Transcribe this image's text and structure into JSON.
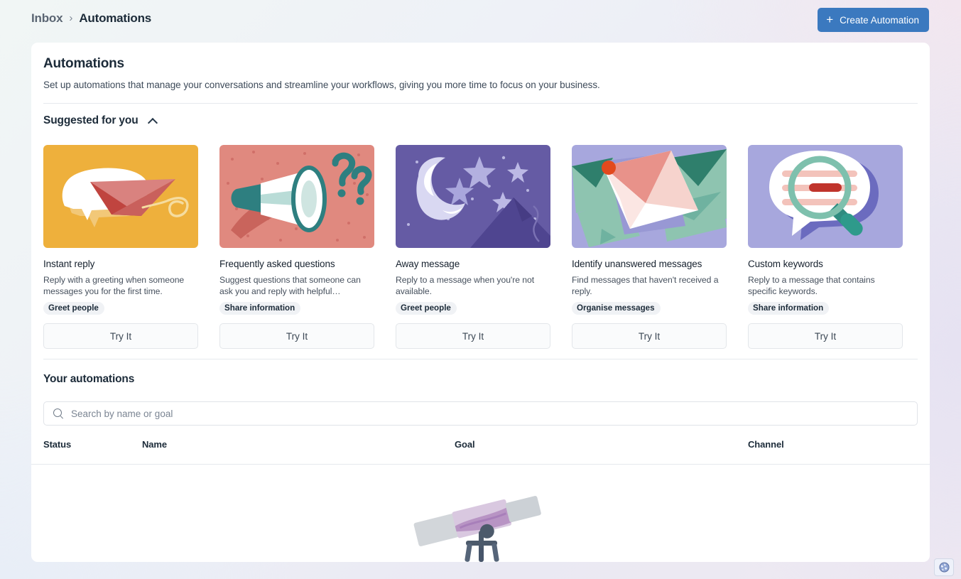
{
  "breadcrumb": {
    "parent": "Inbox",
    "separator": "›",
    "current": "Automations"
  },
  "header": {
    "create_button_label": "Create Automation",
    "create_button_icon": "plus-icon",
    "create_button_color": "#3b79bf"
  },
  "page": {
    "title": "Automations",
    "subtitle": "Set up automations that manage your conversations and streamline your workflows, giving you more time to focus on your business."
  },
  "suggested": {
    "heading": "Suggested for you",
    "collapse_icon": "chevron-up-icon",
    "cards": [
      {
        "title": "Instant reply",
        "description": "Reply with a greeting when someone messages you for the first time.",
        "badge": "Greet people",
        "button_label": "Try It",
        "thumb_name": "instant-reply-illustration",
        "thumb_bg": "#eeb03c"
      },
      {
        "title": "Frequently asked questions",
        "description": "Suggest questions that someone can ask you and reply with helpful…",
        "badge": "Share information",
        "button_label": "Try It",
        "thumb_name": "faq-megaphone-illustration",
        "thumb_bg": "#e0897f"
      },
      {
        "title": "Away message",
        "description": "Reply to a message when you're not available.",
        "badge": "Greet people",
        "button_label": "Try It",
        "thumb_name": "away-message-night-illustration",
        "thumb_bg": "#655ba4"
      },
      {
        "title": "Identify unanswered messages",
        "description": "Find messages that haven't received a reply.",
        "badge": "Organise messages",
        "button_label": "Try It",
        "thumb_name": "unanswered-envelopes-illustration",
        "thumb_bg": "#a7a7dd"
      },
      {
        "title": "Custom keywords",
        "description": "Reply to a message that contains specific keywords.",
        "badge": "Share information",
        "button_label": "Try It",
        "thumb_name": "custom-keywords-magnifier-illustration",
        "thumb_bg": "#a7a7dd"
      }
    ]
  },
  "your_automations": {
    "heading": "Your automations",
    "search": {
      "placeholder": "Search by name or goal",
      "value": "",
      "icon": "search-icon"
    },
    "table": {
      "columns": [
        "Status",
        "Name",
        "Goal",
        "Channel"
      ],
      "rows": []
    },
    "empty_state_illustration": "telescope-illustration"
  },
  "footer": {
    "globe_icon": "globe-icon"
  },
  "scrollbar": {
    "name": "vertical-scrollbar"
  }
}
